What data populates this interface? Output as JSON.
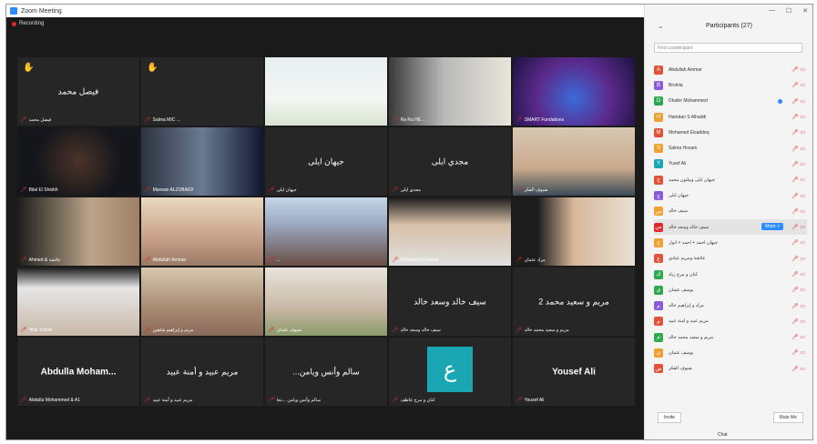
{
  "window": {
    "title": "Zoom Meeting"
  },
  "recording": {
    "label": "Recording"
  },
  "tiles": [
    {
      "center": "فيصل محمد",
      "foot": "فيصل محمد",
      "hand": true
    },
    {
      "center": "",
      "foot": "Salma MIC ...",
      "hand": true
    },
    {
      "center": "",
      "foot": "",
      "active": true
    },
    {
      "center": "",
      "foot": "Ra Ra HE..."
    },
    {
      "center": "",
      "foot": "SMART Fundations"
    },
    {
      "center": "",
      "foot": "Bilal El Sheikh"
    },
    {
      "center": "",
      "foot": "Marwan ALZUBAIDI"
    },
    {
      "center": "جيهان ايلى",
      "foot": "جيهان ايلى"
    },
    {
      "center": "مجدي ايلى",
      "foot": "مجدي ايلى"
    },
    {
      "center": "",
      "foot": "ضيوف الفكر"
    },
    {
      "center": "",
      "foot": "Ahmed & عائشة"
    },
    {
      "center": "",
      "foot": "Abdullah Ammar"
    },
    {
      "center": "",
      "foot": "..."
    },
    {
      "center": "",
      "foot": "Mohamed Elsayed"
    },
    {
      "center": "",
      "foot": "مراد عثمان"
    },
    {
      "center": "",
      "foot": "Hilal Trubisi"
    },
    {
      "center": "",
      "foot": "مريم و إبراهيم شاهين"
    },
    {
      "center": "",
      "foot": "ضيوف عثمان"
    },
    {
      "center": "سيف خالد وسعد خالد",
      "foot": "سيف خالد وسعد خالد"
    },
    {
      "center": "مريم و سعيد محمد 2",
      "foot": "مريم و سعيد محمد خالد"
    },
    {
      "center": "Abdulla   Moham...",
      "foot": "Abdulla Mohammed & A1",
      "big": true
    },
    {
      "center": "مريم عبيد و أمنة عبيد",
      "foot": "مريم عبيد و أمنة عبيد"
    },
    {
      "center": "...سالم وأنس ويامن",
      "foot": "سالم وأنس ويامن ...نجا"
    },
    {
      "center": "",
      "foot": "كنان و مرح عاطف",
      "letter": "ع"
    },
    {
      "center": "Yousef Ali",
      "foot": "Yousef Ali",
      "big": true
    }
  ],
  "panel": {
    "title": "Participants (27)",
    "search_placeholder": "Find a participant",
    "participants": [
      {
        "name": "Abdullah Ammar",
        "color": "#e0533a",
        "letter": "A"
      },
      {
        "name": "Brolnla",
        "color": "#8a5bd6",
        "letter": "B"
      },
      {
        "name": "Dhafer Mohammed",
        "color": "#2fa84f",
        "letter": "D",
        "dot": true
      },
      {
        "name": "Hamdan S Alhaddi",
        "color": "#f0a030",
        "letter": "H"
      },
      {
        "name": "Mohamed Elsaddeq",
        "color": "#e0533a",
        "letter": "M"
      },
      {
        "name": "Salma Hosam",
        "color": "#f0a030",
        "letter": "S"
      },
      {
        "name": "Yusef Ali",
        "color": "#1aa7b3",
        "letter": "Y"
      },
      {
        "name": "جيهان ايلى وبيلتون محمد",
        "color": "#e0533a",
        "letter": "ج"
      },
      {
        "name": "جيهان ايلى",
        "color": "#8a5bd6",
        "letter": "ج"
      },
      {
        "name": "سيف خالد",
        "color": "#f0a030",
        "letter": "س"
      },
      {
        "name": "سيف خالد وسعد خالد",
        "color": "#e02828",
        "letter": "س",
        "more": true
      },
      {
        "name": "جيهان احمد + احمد + انوار",
        "color": "#f0a030",
        "letter": "ج"
      },
      {
        "name": "عائشة ومريم عيادي",
        "color": "#e0533a",
        "letter": "ع"
      },
      {
        "name": "كنان و مرح زياد",
        "color": "#2fa84f",
        "letter": "ك"
      },
      {
        "name": "يوسف عثمان",
        "color": "#2fa84f",
        "letter": "ي"
      },
      {
        "name": "مراد و إبراهيم خالد",
        "color": "#8a5bd6",
        "letter": "م"
      },
      {
        "name": "مريم عبيد و أمنة عبيد",
        "color": "#e0533a",
        "letter": "م"
      },
      {
        "name": "مريم و سعيد محمد خالد",
        "color": "#2fa84f",
        "letter": "م"
      },
      {
        "name": "يوسف عثمان",
        "color": "#f0a030",
        "letter": "ي"
      },
      {
        "name": "ضيوف الفكر",
        "color": "#e0533a",
        "letter": "ض"
      }
    ],
    "more_label": "More >",
    "invite_label": "Invite",
    "mute_all_label": "Mute Me",
    "chat_label": "Chat"
  }
}
